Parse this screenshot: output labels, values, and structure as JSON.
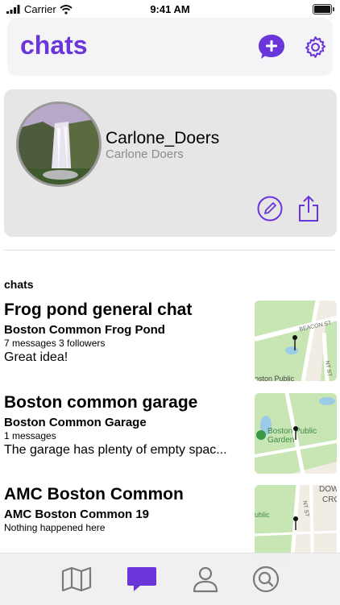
{
  "status_bar": {
    "carrier": "Carrier",
    "time": "9:41 AM"
  },
  "header": {
    "title": "chats"
  },
  "profile": {
    "username": "Carlone_Doers",
    "full_name": "Carlone  Doers"
  },
  "section": {
    "title": "chats"
  },
  "chats": [
    {
      "title": "Frog pond general chat",
      "place": "Boston Common Frog Pond",
      "stats": "7 messages   3 followers",
      "last_message": "Great idea!",
      "map_labels": [
        "BEACON ST",
        "oston Public",
        "NT ST"
      ]
    },
    {
      "title": "Boston common garage",
      "place": "Boston Common Garage",
      "stats": "1 messages",
      "last_message": "The garage has plenty of empty spac...",
      "map_labels": [
        "Boston Public",
        "Garden"
      ]
    },
    {
      "title": "AMC Boston Common",
      "place": "AMC Boston Common 19",
      "stats": "",
      "last_message": "Nothing happened here",
      "map_labels": [
        "DOW",
        "CRO",
        "ublic",
        "NT ST"
      ]
    }
  ],
  "tabs": [
    {
      "icon": "map-icon",
      "active": false
    },
    {
      "icon": "chat-bubble-icon",
      "active": true
    },
    {
      "icon": "person-icon",
      "active": false
    },
    {
      "icon": "search-icon",
      "active": false
    }
  ],
  "colors": {
    "accent": "#6a35d9",
    "inactive_icon": "#7a7a7a"
  }
}
